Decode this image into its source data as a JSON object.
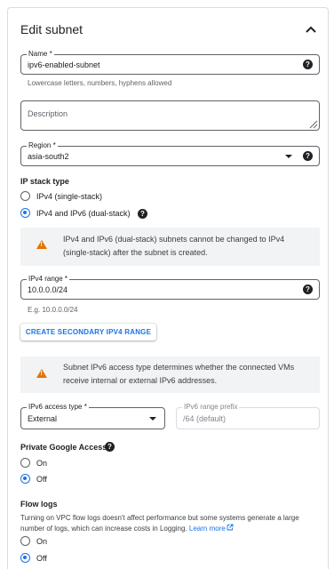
{
  "header": {
    "title": "Edit subnet"
  },
  "name_field": {
    "label": "Name *",
    "value": "ipv6-enabled-subnet",
    "hint": "Lowercase letters, numbers, hyphens allowed"
  },
  "description_field": {
    "placeholder": "Description"
  },
  "region_field": {
    "label": "Region *",
    "value": "asia-south2"
  },
  "ip_stack": {
    "title": "IP stack type",
    "options": [
      {
        "label": "IPv4 (single-stack)",
        "selected": false
      },
      {
        "label": "IPv4 and IPv6 (dual-stack)",
        "selected": true
      }
    ]
  },
  "dual_stack_notice": "IPv4 and IPv6 (dual-stack) subnets cannot be changed to IPv4 (single-stack) after the subnet is created.",
  "ipv4_range": {
    "label": "IPv4 range *",
    "value": "10.0.0.0/24",
    "hint": "E.g. 10.0.0.0/24"
  },
  "secondary_button": "CREATE SECONDARY IPV4 RANGE",
  "ipv6_notice": "Subnet IPv6 access type determines whether the connected VMs receive internal or external IPv6 addresses.",
  "ipv6_access_type": {
    "label": "IPv6 access type *",
    "value": "External"
  },
  "ipv6_prefix": {
    "label": "IPv6 range prefix",
    "value": "/64 (default)"
  },
  "private_google_access": {
    "title": "Private Google Access",
    "options": [
      {
        "label": "On",
        "selected": false
      },
      {
        "label": "Off",
        "selected": true
      }
    ]
  },
  "flow_logs": {
    "title": "Flow logs",
    "description": "Turning on VPC flow logs doesn't affect performance but some systems generate a large number of logs, which can increase costs in Logging.",
    "link": "Learn more",
    "options": [
      {
        "label": "On",
        "selected": false
      },
      {
        "label": "Off",
        "selected": true
      }
    ]
  },
  "colors": {
    "accent": "#1a73e8",
    "warning": "#e37400",
    "callout_bg": "#f1f3f4",
    "border": "#5f6368"
  },
  "icons": [
    "chevron-up-icon",
    "help-icon",
    "warning-icon",
    "dropdown-arrow-icon",
    "resize-handle-icon",
    "external-link-icon"
  ]
}
